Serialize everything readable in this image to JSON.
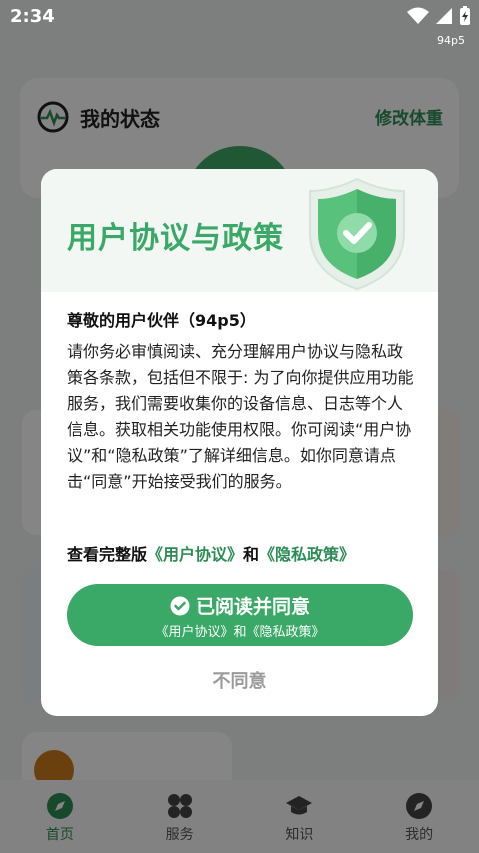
{
  "status_bar": {
    "time": "2:34",
    "app_badge": "94p5"
  },
  "background": {
    "status_title": "我的状态",
    "edit_weight": "修改体重",
    "tabs": [
      {
        "label": "首页",
        "icon": "compass-icon",
        "active": true
      },
      {
        "label": "服务",
        "icon": "grid-icon",
        "active": false
      },
      {
        "label": "知识",
        "icon": "graduation-cap-icon",
        "active": false
      },
      {
        "label": "我的",
        "icon": "compass-icon",
        "active": false
      }
    ]
  },
  "dialog": {
    "title": "用户协议与政策",
    "greeting": "尊敬的用户伙伴（94p5）",
    "body": "请你务必审慎阅读、充分理解用户协议与隐私政策各条款，包括但不限于: 为了向你提供应用功能服务，我们需要收集你的设备信息、日志等个人信息。获取相关功能使用权限。你可阅读“用户协议”和“隐私政策”了解详细信息。如你同意请点击“同意”开始接受我们的服务。",
    "links_prefix": "查看完整版",
    "user_agreement_link": "《用户协议》",
    "links_and": "和",
    "privacy_link": "《隐私政策》",
    "agree_label": "已阅读并同意",
    "agree_sub": "《用户协议》和《隐私政策》",
    "disagree_label": "不同意"
  },
  "colors": {
    "accent": "#3aa866",
    "accent_dark": "#2d8c55"
  }
}
